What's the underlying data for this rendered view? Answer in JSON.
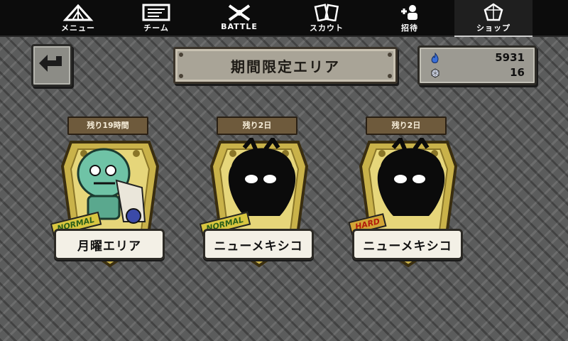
{
  "nav": {
    "items": [
      {
        "label": "メニュー",
        "icon": "tent-icon"
      },
      {
        "label": "チーム",
        "icon": "map-icon"
      },
      {
        "label": "BATTLE",
        "icon": "crossed-guns-icon"
      },
      {
        "label": "スカウト",
        "icon": "cards-icon"
      },
      {
        "label": "招待",
        "icon": "add-friend-icon"
      },
      {
        "label": "ショップ",
        "icon": "gem-icon"
      }
    ],
    "active_index": 5
  },
  "header": {
    "title": "期間限定エリア"
  },
  "currency": {
    "primary_value": "5931",
    "primary_icon": "blue-flame-icon",
    "secondary_value": "16",
    "secondary_icon": "crystal-icon"
  },
  "areas": [
    {
      "timer": "残り19時間",
      "name": "月曜エリア",
      "difficulty": "NORMAL",
      "revealed": true
    },
    {
      "timer": "残り2日",
      "name": "ニューメキシコ",
      "difficulty": "NORMAL",
      "revealed": false
    },
    {
      "timer": "残り2日",
      "name": "ニューメキシコ",
      "difficulty": "HARD",
      "revealed": false
    }
  ],
  "colors": {
    "gold": "#c9b24a",
    "normal_badge": "#d8c640",
    "hard_badge": "#d2a536"
  }
}
